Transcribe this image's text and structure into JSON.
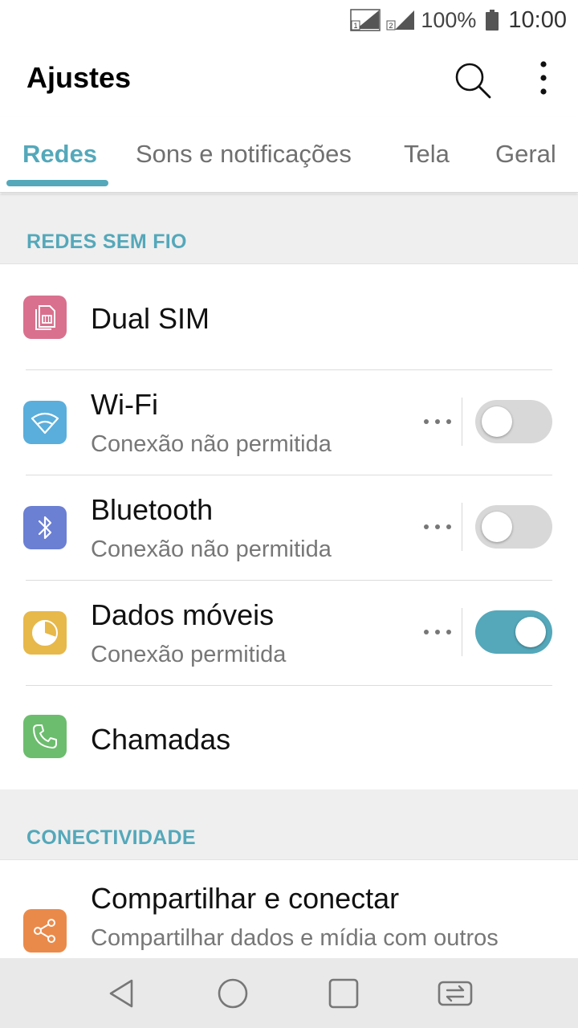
{
  "status_bar": {
    "battery_text": "100%",
    "time": "10:00",
    "sim1_label": "1",
    "sim2_label": "2"
  },
  "app_bar": {
    "title": "Ajustes",
    "search_icon": "search-icon",
    "more_icon": "more-vert-icon"
  },
  "tabs": [
    {
      "label": "Redes",
      "active": true
    },
    {
      "label": "Sons e notificações",
      "active": false
    },
    {
      "label": "Tela",
      "active": false
    },
    {
      "label": "Geral",
      "active": false
    }
  ],
  "sections": {
    "wireless": {
      "header": "REDES SEM FIO"
    },
    "connectivity": {
      "header": "CONECTIVIDADE"
    }
  },
  "items": {
    "dual_sim": {
      "title": "Dual SIM",
      "icon": "sim-card-icon",
      "color": "#d9708e"
    },
    "wifi": {
      "title": "Wi-Fi",
      "subtitle": "Conexão não permitida",
      "icon": "wifi-icon",
      "color": "#5aaedb",
      "enabled": false
    },
    "bluetooth": {
      "title": "Bluetooth",
      "subtitle": "Conexão não permitida",
      "icon": "bluetooth-icon",
      "color": "#6b7fd3",
      "enabled": false
    },
    "mobile_data": {
      "title": "Dados móveis",
      "subtitle": "Conexão permitida",
      "icon": "data-usage-icon",
      "color": "#e7b84a",
      "enabled": true
    },
    "calls": {
      "title": "Chamadas",
      "icon": "phone-icon",
      "color": "#6cbd6e"
    },
    "share": {
      "title": "Compartilhar e conectar",
      "subtitle": "Compartilhar dados e mídia com outros",
      "icon": "share-icon",
      "color": "#ea8a4a"
    }
  },
  "colors": {
    "accent": "#54a8ba",
    "section_background": "#efefef",
    "navbar_background": "#e9e9e9"
  },
  "nav_bar": {
    "back_icon": "back-triangle-icon",
    "home_icon": "home-circle-icon",
    "recents_icon": "recents-square-icon",
    "switch_icon": "dual-window-switch-icon"
  }
}
